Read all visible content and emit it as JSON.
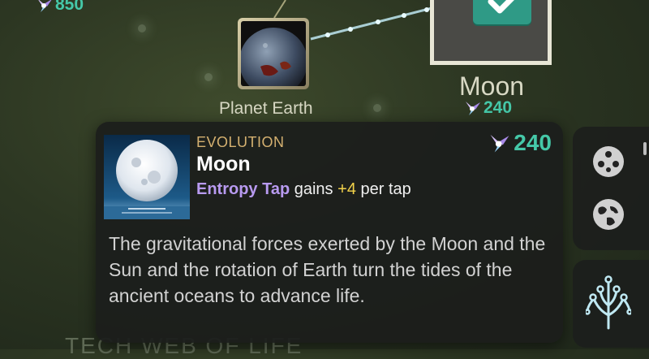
{
  "currency": {
    "icon": "entropy-crystal-icon",
    "color": "#45c8a8"
  },
  "map": {
    "top_cost": "850",
    "nodes": [
      {
        "label": "Planet Earth"
      },
      {
        "label": "Moon",
        "cost": "240",
        "status": "purchased-check-icon"
      }
    ],
    "background_text": "TECH WEB OF LIFE"
  },
  "detail": {
    "category": "EVOLUTION",
    "title": "Moon",
    "cost": "240",
    "effect": {
      "highlight": "Entropy Tap",
      "text1": " gains ",
      "sign": "+",
      "amount": "4",
      "text2": " per tap"
    },
    "description": "The gravitational forces exerted by the Moon and the Sun and the rotation of Earth turn the tides of the ancient oceans to advance life."
  },
  "sidebar": {
    "buttons": [
      "particles-icon",
      "globe-icon",
      "tree-of-life-icon"
    ]
  }
}
